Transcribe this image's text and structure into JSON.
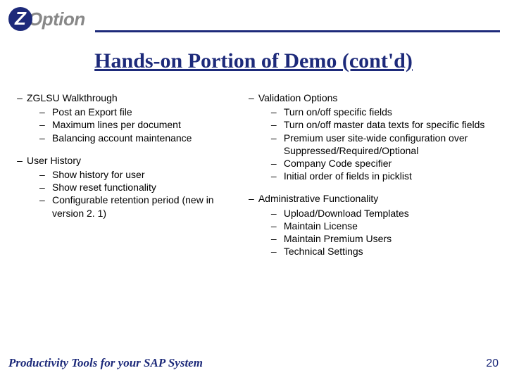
{
  "logo": {
    "letter": "Z",
    "word": "Option"
  },
  "title": "Hands-on Portion of Demo (cont'd)",
  "left_col": [
    {
      "label": "ZGLSU Walkthrough",
      "items": [
        "Post an Export file",
        "Maximum lines per document",
        "Balancing account maintenance"
      ]
    },
    {
      "label": "User History",
      "items": [
        "Show history for user",
        "Show reset functionality",
        "Configurable retention period (new in version 2. 1)"
      ]
    }
  ],
  "right_col": [
    {
      "label": "Validation Options",
      "items": [
        "Turn on/off specific fields",
        "Turn on/off master data texts for specific fields",
        "Premium user site-wide configuration over Suppressed/Required/Optional",
        "Company Code specifier",
        "Initial order of fields in picklist"
      ]
    },
    {
      "label": "Administrative Functionality",
      "items": [
        "Upload/Download Templates",
        "Maintain License",
        "Maintain Premium Users",
        "Technical Settings"
      ]
    }
  ],
  "footer": {
    "tagline": "Productivity Tools for your SAP System",
    "page": "20"
  }
}
